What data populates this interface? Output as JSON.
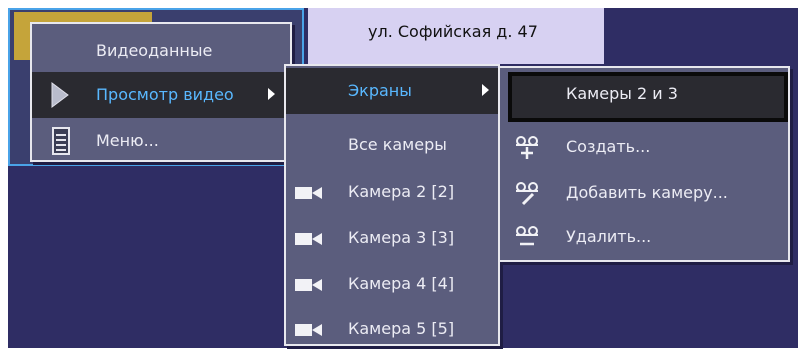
{
  "background": {
    "address": "ул. Софийская д. 47"
  },
  "menu_main": {
    "items": [
      {
        "label": "Видеоданные"
      },
      {
        "label": "Просмотр видео"
      },
      {
        "label": "Меню..."
      }
    ]
  },
  "menu_view": {
    "items": [
      {
        "label": "Экраны"
      },
      {
        "label": "Все камеры"
      },
      {
        "label": "Камера 2 [2]"
      },
      {
        "label": "Камера 3 [3]"
      },
      {
        "label": "Камера 4 [4]"
      },
      {
        "label": "Камера 5 [5]"
      }
    ]
  },
  "menu_screens": {
    "items": [
      {
        "label": "Камеры 2 и 3"
      },
      {
        "label": "Создать..."
      },
      {
        "label": "Добавить камеру..."
      },
      {
        "label": "Удалить..."
      }
    ]
  },
  "colors": {
    "desktop": "#2f2d64",
    "menu_bg": "#5b5d7d",
    "active_text": "#59b8ff",
    "address_bar": "#d7d1f2",
    "tab_accent": "#c5a43a"
  },
  "icons": {
    "play": "play-icon",
    "menu_list": "menu-list-icon",
    "camera": "camera-icon",
    "create": "screen-create-icon",
    "add_camera": "screen-add-camera-icon",
    "delete": "screen-delete-icon"
  }
}
